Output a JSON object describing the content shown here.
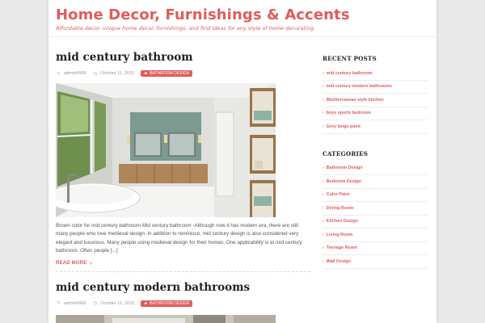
{
  "site": {
    "title": "Home Decor, Furnishings & Accents",
    "tagline": "Affordable decor, unique home decor, furnishings, and find ideas for any style of home decorating"
  },
  "posts": [
    {
      "title": "mid century bathroom",
      "author": "admin0408",
      "date": "October 11, 2015",
      "category": "Bathroom Design",
      "excerpt": "Brown color for mid century bathroom Mid century bathroom -Although now it has modern era, there are still many people who love medieval design. In addition to reminisce, mid century design is also considered very elegant and luxurious. Many people using medieval design for their homes. One applicability is at mid century bathroom. Often people [...]",
      "read_more": "Read More"
    },
    {
      "title": "mid century modern bathrooms",
      "author": "admin0408",
      "date": "October 11, 2015",
      "category": "Bathroom Design"
    }
  ],
  "sidebar": {
    "recent_title": "Recent Posts",
    "recent_posts": [
      "mid century bathroom",
      "mid century modern bathrooms",
      "Mediterranean style kitchen",
      "boys sports bedroom",
      "Grey beige paint"
    ],
    "categories_title": "Categories",
    "categories": [
      "Bathroom Design",
      "Bedroom Design",
      "Color Paint",
      "Dining Room",
      "Kitchen Design",
      "Living Room",
      "Teenage Room",
      "Wall Design"
    ]
  },
  "icons": {
    "author": "pencil-icon",
    "date": "clock-icon",
    "category": "folder-icon",
    "read_more": "chevron-right-icon",
    "list_bullet": "chevron-right-icon"
  },
  "colors": {
    "accent": "#e05c5c",
    "page_bg": "#e9e9e9",
    "content_bg": "#ffffff"
  }
}
